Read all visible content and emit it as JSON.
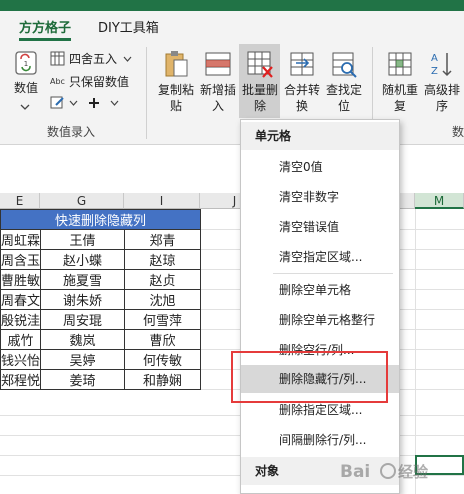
{
  "tabs": [
    {
      "label": "方方格子",
      "active": true
    },
    {
      "label": "DIY工具箱",
      "active": false
    }
  ],
  "ribbon": {
    "shuzhi_label": "数值",
    "sishe_label": "四舍五入",
    "abc_icon_text": "Abc",
    "baoliu_label": "只保留数值",
    "group_label": "数值录入",
    "copy_paste_line1": "复制粘",
    "copy_paste_line2": "贴",
    "new_insert_line1": "新增插",
    "new_insert_line2": "入",
    "batch_delete_line1": "批量删",
    "batch_delete_line2": "除",
    "merge_convert_line1": "合并转",
    "merge_convert_line2": "换",
    "locate_line1": "查找定",
    "locate_line2": "位",
    "random_line1": "随机重",
    "random_line2": "复",
    "advanced_line1": "高级排",
    "advanced_line2": "序",
    "partial_group_label": "数"
  },
  "sheet": {
    "col_headers": [
      "E",
      "G",
      "I",
      "J",
      "M"
    ],
    "title": "快速删除隐藏列",
    "rows": [
      [
        "周虹霖",
        "王倩",
        "郑青"
      ],
      [
        "周含玉",
        "赵小蝶",
        "赵琼"
      ],
      [
        "曹胜敏",
        "施夏雪",
        "赵贞"
      ],
      [
        "周春文",
        "谢朱娇",
        "沈旭"
      ],
      [
        "殷锐洼",
        "周安琨",
        "何雪萍"
      ],
      [
        "戚竹",
        "魏岚",
        "曹欣"
      ],
      [
        "钱兴怡",
        "吴婷",
        "何传敏"
      ],
      [
        "郑程悦",
        "姜琦",
        "和静娴"
      ]
    ]
  },
  "menu": {
    "header_cells": "单元格",
    "items": [
      "清空0值",
      "清空非数字",
      "清空错误值",
      "清空指定区域...",
      "删除空单元格",
      "删除空单元格整行",
      "删除空行/列...",
      "删除隐藏行/列...",
      "删除指定区域...",
      "间隔删除行/列..."
    ],
    "header_objects": "对象"
  },
  "watermark": "Bai度经验",
  "colors": {
    "excel_green": "#217346",
    "title_blue": "#4472c4",
    "highlight_red": "#e53b3b"
  }
}
